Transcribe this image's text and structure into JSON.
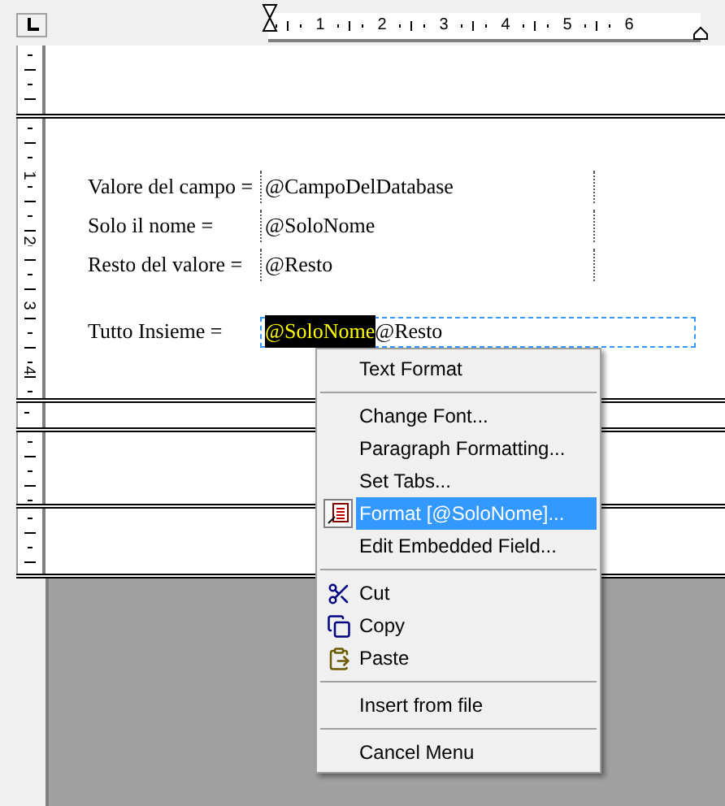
{
  "ruler": {
    "marks": [
      "1",
      "2",
      "3",
      "4",
      "5",
      "6"
    ]
  },
  "vertical_ruler": {
    "marks": [
      "1",
      "2",
      "3",
      "4"
    ]
  },
  "rows": [
    {
      "kind": "single",
      "label": "Valore del campo =",
      "field": "@CampoDelDatabase"
    },
    {
      "kind": "single",
      "label": "Solo il nome =",
      "field": "@SoloNome"
    },
    {
      "kind": "single",
      "label": "Resto del valore =",
      "field": "@Resto"
    },
    {
      "kind": "combined",
      "label": "Tutto Insieme =",
      "fields": [
        {
          "text": "@SoloNome",
          "selected": true
        },
        {
          "text": "@Resto",
          "selected": false
        }
      ]
    }
  ],
  "context_menu": {
    "groups": [
      [
        {
          "kind": "plain",
          "label": "Text Format",
          "selected": false
        }
      ],
      [
        {
          "kind": "plain",
          "label": "Change Font...",
          "selected": false
        },
        {
          "kind": "plain",
          "label": "Paragraph Formatting...",
          "selected": false
        },
        {
          "kind": "plain",
          "label": "Set Tabs...",
          "selected": false
        },
        {
          "kind": "format",
          "label": "Format [@SoloNome]...",
          "selected": true
        },
        {
          "kind": "plain",
          "label": "Edit Embedded Field...",
          "selected": false
        }
      ],
      [
        {
          "kind": "cut",
          "label": "Cut",
          "selected": false
        },
        {
          "kind": "copy",
          "label": "Copy",
          "selected": false
        },
        {
          "kind": "paste",
          "label": "Paste",
          "selected": false
        }
      ],
      [
        {
          "kind": "plain",
          "label": "Insert from file",
          "selected": false
        }
      ],
      [
        {
          "kind": "plain",
          "label": "Cancel Menu",
          "selected": false
        }
      ]
    ]
  }
}
